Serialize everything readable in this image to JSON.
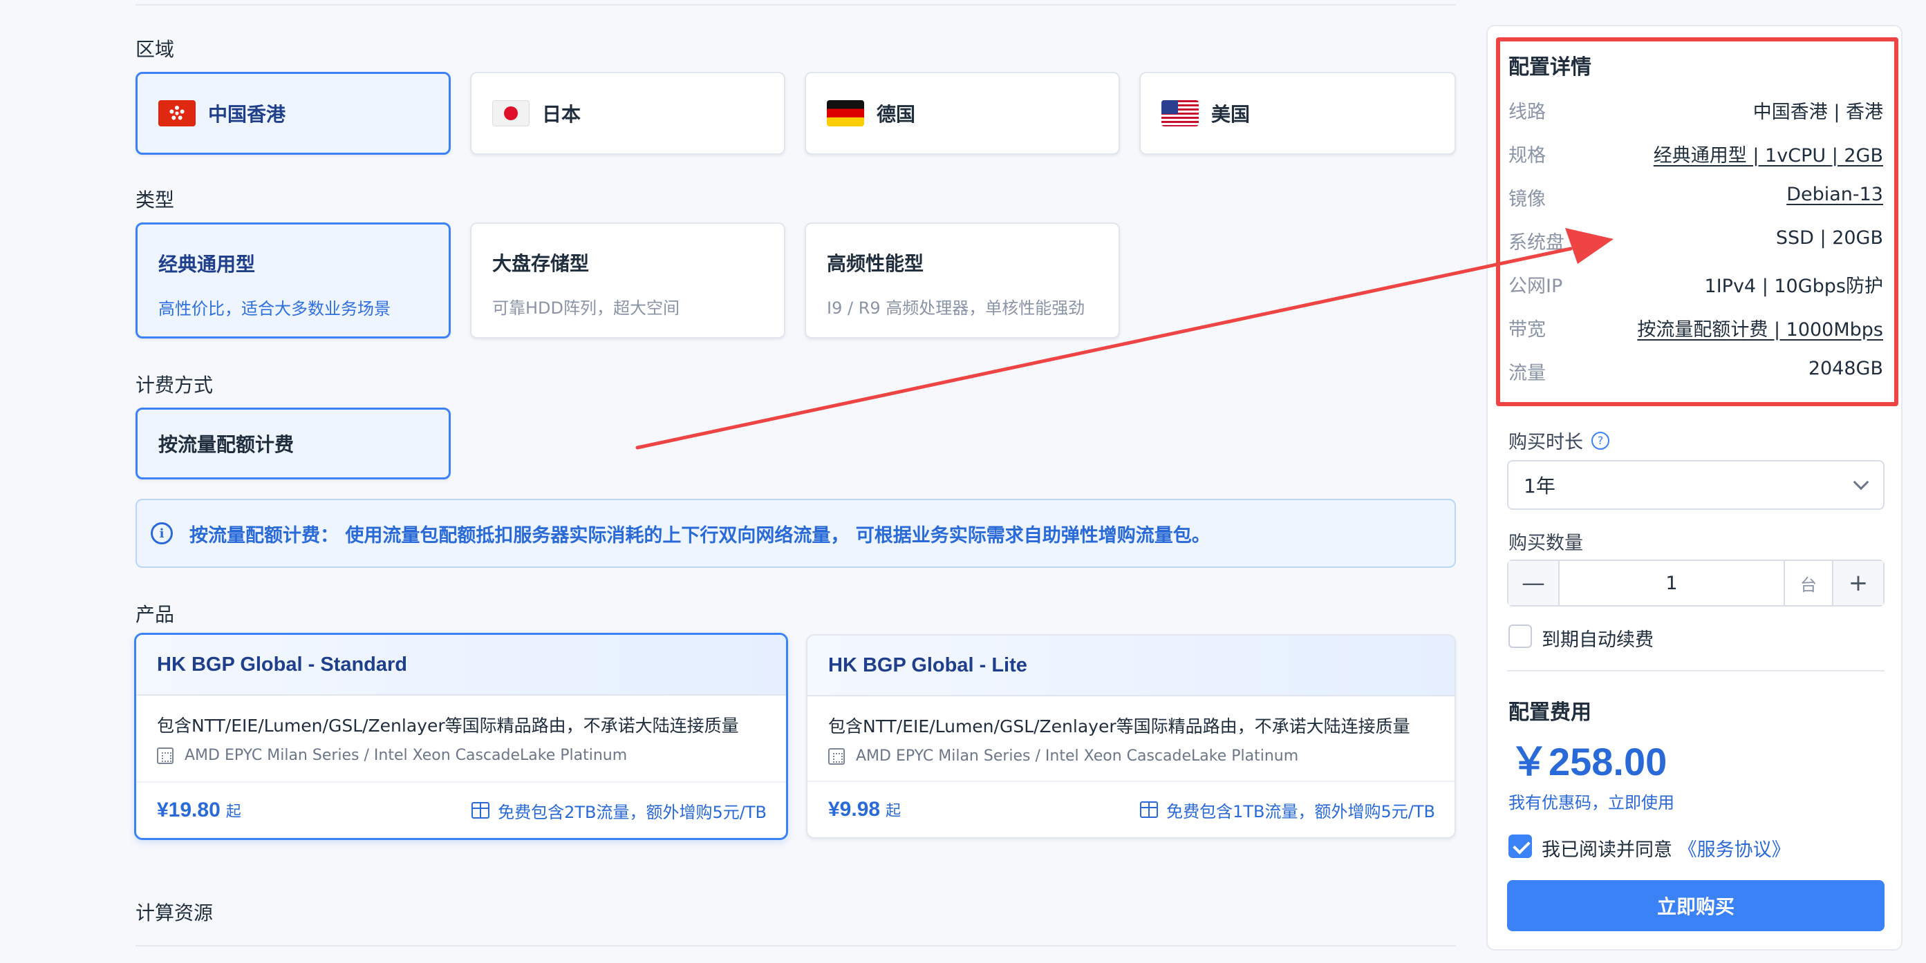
{
  "sections": {
    "region": "区域",
    "type": "类型",
    "billing": "计费方式",
    "product": "产品",
    "compute": "计算资源"
  },
  "regions": [
    {
      "label": "中国香港",
      "flag": "hk-flag-icon",
      "selected": true
    },
    {
      "label": "日本",
      "flag": "jp-flag-icon",
      "selected": false
    },
    {
      "label": "德国",
      "flag": "de-flag-icon",
      "selected": false
    },
    {
      "label": "美国",
      "flag": "us-flag-icon",
      "selected": false
    }
  ],
  "types": [
    {
      "title": "经典通用型",
      "sub": "高性价比，适合大多数业务场景",
      "selected": true
    },
    {
      "title": "大盘存储型",
      "sub": "可靠HDD阵列，超大空间",
      "selected": false
    },
    {
      "title": "高频性能型",
      "sub": "I9 / R9 高频处理器，单核性能强劲",
      "selected": false
    }
  ],
  "billing": {
    "label": "按流量配额计费"
  },
  "notice": {
    "text": "按流量配额计费： 使用流量包配额抵扣服务器实际消耗的上下行双向网络流量， 可根据业务实际需求自助弹性增购流量包。"
  },
  "products": [
    {
      "name": "HK BGP Global - Standard",
      "desc": "包含NTT/EIE/Lumen/GSL/Zenlayer等国际精品路由，不承诺大陆连接质量",
      "cpu": "AMD EPYC Milan Series / Intel Xeon CascadeLake Platinum",
      "price": "¥19.80",
      "price_suffix": "起",
      "gift": "免费包含2TB流量，额外增购5元/TB",
      "selected": true
    },
    {
      "name": "HK BGP Global - Lite",
      "desc": "包含NTT/EIE/Lumen/GSL/Zenlayer等国际精品路由，不承诺大陆连接质量",
      "cpu": "AMD EPYC Milan Series / Intel Xeon CascadeLake Platinum",
      "price": "¥9.98",
      "price_suffix": "起",
      "gift": "免费包含1TB流量，额外增购5元/TB",
      "selected": false
    }
  ],
  "config": {
    "title": "配置详情",
    "rows": [
      {
        "k": "线路",
        "v": "中国香港 | 香港"
      },
      {
        "k": "规格",
        "v": "经典通用型 | 1vCPU | 2GB"
      },
      {
        "k": "镜像",
        "v": "Debian-13"
      },
      {
        "k": "系统盘",
        "v": "SSD | 20GB"
      },
      {
        "k": "公网IP",
        "v": "1IPv4 | 10Gbps防护"
      },
      {
        "k": "带宽",
        "v": "按流量配额计费 | 1000Mbps"
      },
      {
        "k": "流量",
        "v": "2048GB"
      }
    ]
  },
  "purchase": {
    "duration_label": "购买时长",
    "duration_help_icon": "question-icon",
    "duration_value": "1年",
    "qty_label": "购买数量",
    "qty_minus": "—",
    "qty_value": "1",
    "qty_unit": "台",
    "qty_plus": "+",
    "auto_renew": "到期自动续费",
    "fee_title": "配置费用",
    "fee_price": "￥258.00",
    "coupon": "我有优惠码，立即使用",
    "agree_text": "我已阅读并同意 ",
    "agree_link": "《服务协议》",
    "buy": "立即购买"
  },
  "colors": {
    "accent": "#3b82f6",
    "link": "#2a6ad8",
    "annotation": "#ef4444"
  }
}
